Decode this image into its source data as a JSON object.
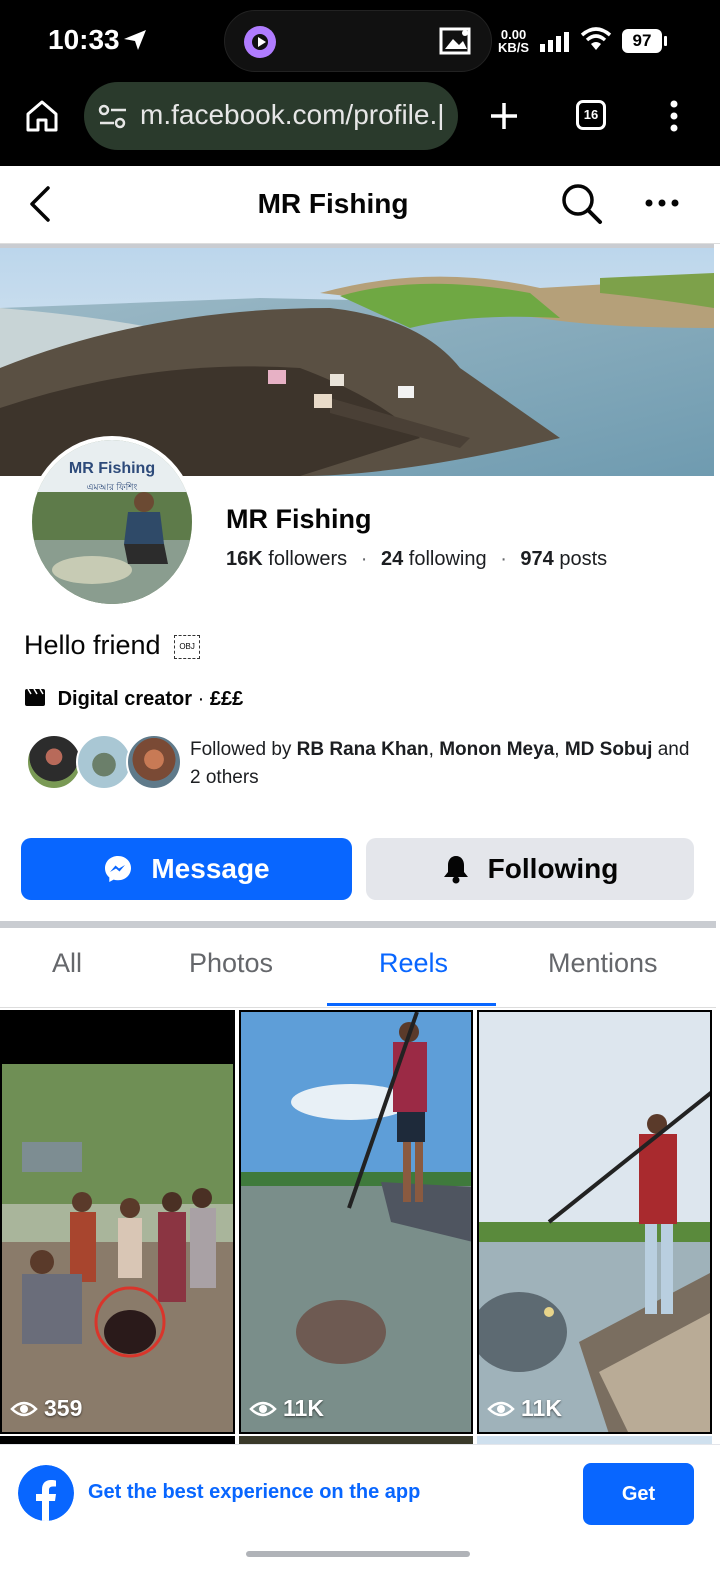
{
  "status_bar": {
    "time": "10:33",
    "net_speed_value": "0.00",
    "net_speed_unit": "KB/S",
    "battery": "97"
  },
  "browser": {
    "url": "m.facebook.com/profile.|",
    "tab_count": "16"
  },
  "header": {
    "title": "MR Fishing"
  },
  "profile": {
    "avatar_label": "MR Fishing",
    "avatar_sub": "এমআর ফিশিং",
    "name": "MR Fishing",
    "followers_count": "16K",
    "followers_label": "followers",
    "following_count": "24",
    "following_label": "following",
    "posts_count": "974",
    "posts_label": "posts",
    "bio": "Hello friend",
    "obj_glyph": "OBJ",
    "category": "Digital creator",
    "category_extra": "£££",
    "followed_by_prefix": "Followed by",
    "followed_by_names": [
      "RB Rana Khan",
      "Monon Meya",
      "MD Sobuj"
    ],
    "followed_by_suffix": "and 2 others"
  },
  "actions": {
    "message_label": "Message",
    "following_label": "Following"
  },
  "tabs": [
    {
      "label": "All",
      "active": false
    },
    {
      "label": "Photos",
      "active": false
    },
    {
      "label": "Reels",
      "active": true
    },
    {
      "label": "Mentions",
      "active": false
    }
  ],
  "reels": [
    {
      "views": "359"
    },
    {
      "views": "11K"
    },
    {
      "views": "11K"
    }
  ],
  "app_banner": {
    "text": "Get the best experience on the app",
    "button_label": "Get"
  },
  "colors": {
    "accent": "#0866ff",
    "secondary_button": "#e4e6eb"
  }
}
